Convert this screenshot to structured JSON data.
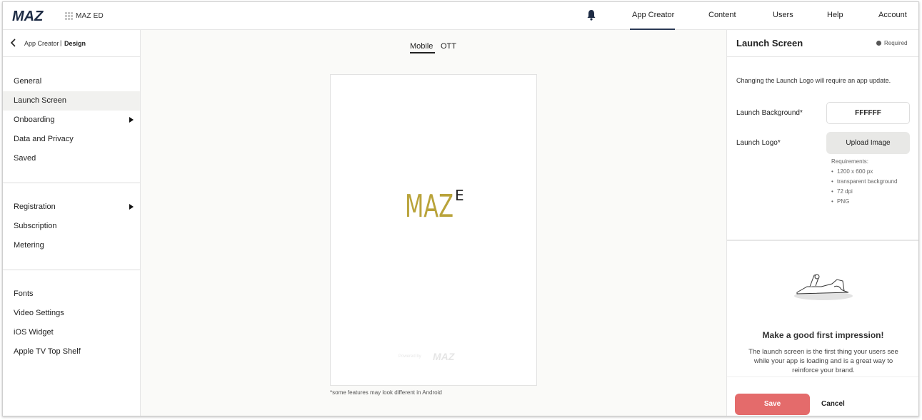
{
  "topbar": {
    "logo_text": "MAZ",
    "app_name": "MAZ ED",
    "nav": [
      {
        "label": "App Creator"
      },
      {
        "label": "Content"
      },
      {
        "label": "Users"
      },
      {
        "label": "Help"
      },
      {
        "label": "Account"
      }
    ],
    "active_nav": "App Creator",
    "accent_color": "#2b3a55"
  },
  "breadcrumb": {
    "parent": "App Creator",
    "separator": "|",
    "current": "Design"
  },
  "sidebar": {
    "groups": [
      {
        "items": [
          {
            "label": "General"
          },
          {
            "label": "Launch Screen",
            "active": true
          },
          {
            "label": "Onboarding",
            "has_submenu": true
          },
          {
            "label": "Data and Privacy"
          },
          {
            "label": "Saved"
          }
        ]
      },
      {
        "items": [
          {
            "label": "Registration",
            "has_submenu": true
          },
          {
            "label": "Subscription"
          },
          {
            "label": "Metering"
          }
        ]
      },
      {
        "items": [
          {
            "label": "Fonts"
          },
          {
            "label": "Video Settings"
          },
          {
            "label": "iOS Widget"
          },
          {
            "label": "Apple TV Top Shelf"
          }
        ]
      }
    ]
  },
  "preview": {
    "tabs": [
      {
        "label": "Mobile",
        "active": true
      },
      {
        "label": "OTT"
      }
    ],
    "logo_text": "MAZ",
    "logo_suffix": "ED",
    "logo_color": "#b9a33a",
    "powered_by": "Powered by",
    "footnote": "*some features may look different in Android"
  },
  "panel": {
    "title": "Launch Screen",
    "required_label": "Required",
    "description": "Changing the Launch Logo will require an app update.",
    "background_label": "Launch Background*",
    "background_value": "FFFFFF",
    "logo_label": "Launch Logo*",
    "upload_label": "Upload Image",
    "requirements_title": "Requirements:",
    "requirements": [
      "1200 x 600 px",
      "transparent background",
      "72 dpi",
      "PNG"
    ],
    "impression_title": "Make a good first impression!",
    "impression_text": "The launch screen is the first thing your users see while your app is loading and is a great way to reinforce your brand.",
    "save_label": "Save",
    "cancel_label": "Cancel",
    "save_color": "#e46b6b"
  }
}
